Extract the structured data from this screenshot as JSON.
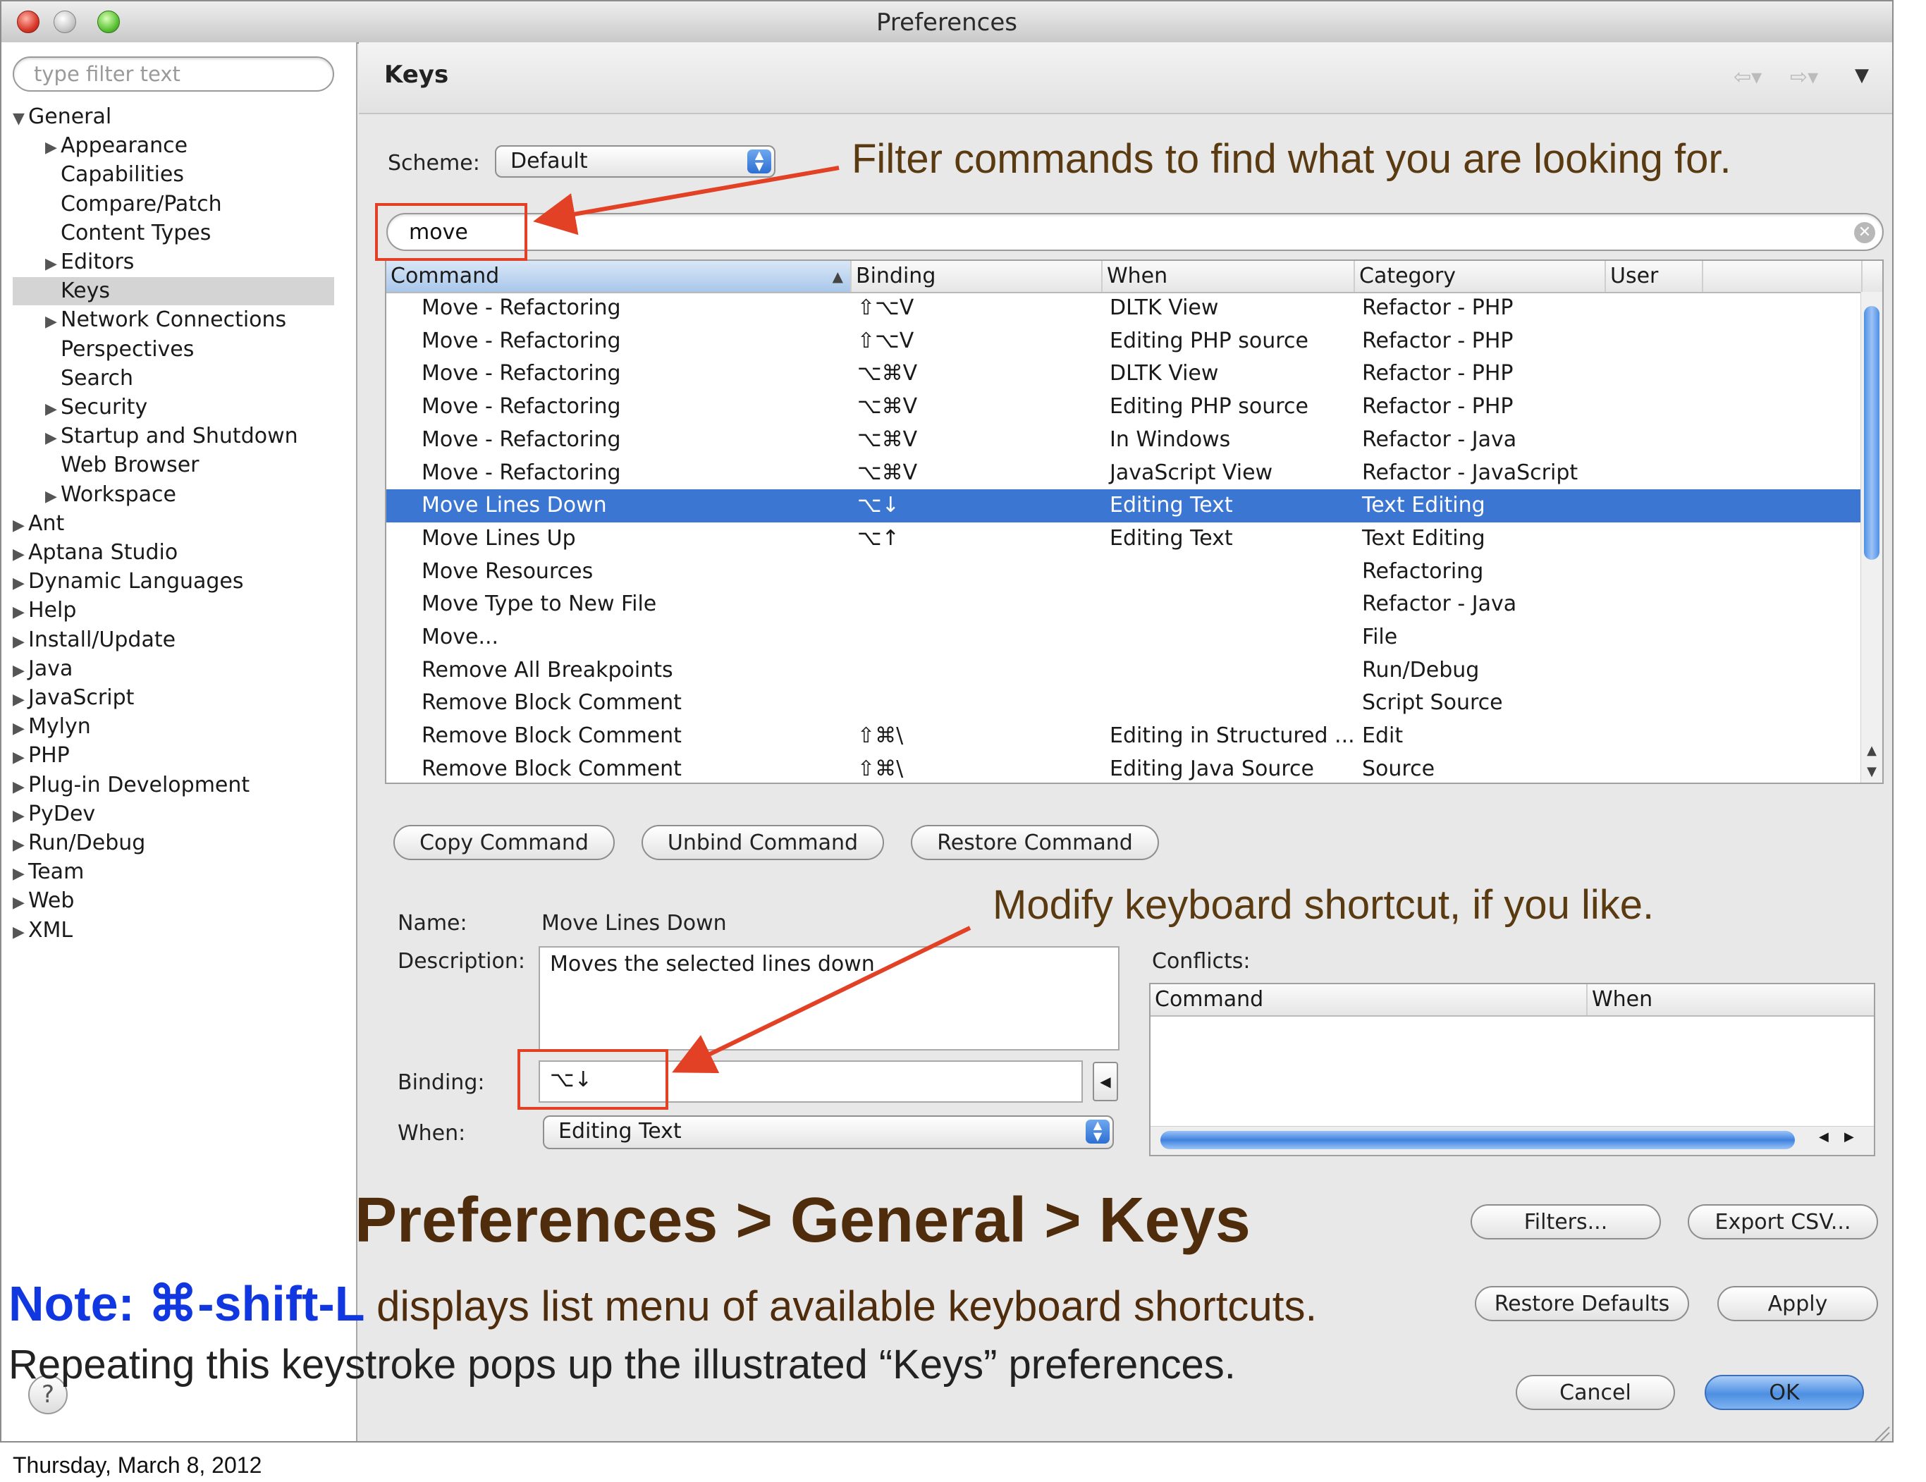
{
  "window": {
    "title": "Preferences"
  },
  "sidebar": {
    "filter_placeholder": "type filter text",
    "items": [
      {
        "label": "General",
        "expanded": true
      },
      {
        "label": "Appearance",
        "expandable": true
      },
      {
        "label": "Capabilities"
      },
      {
        "label": "Compare/Patch"
      },
      {
        "label": "Content Types"
      },
      {
        "label": "Editors",
        "expandable": true
      },
      {
        "label": "Keys",
        "selected": true
      },
      {
        "label": "Network Connections",
        "expandable": true
      },
      {
        "label": "Perspectives"
      },
      {
        "label": "Search"
      },
      {
        "label": "Security",
        "expandable": true
      },
      {
        "label": "Startup and Shutdown",
        "expandable": true
      },
      {
        "label": "Web Browser"
      },
      {
        "label": "Workspace",
        "expandable": true
      },
      {
        "label": "Ant",
        "expandable": true
      },
      {
        "label": "Aptana Studio",
        "expandable": true
      },
      {
        "label": "Dynamic Languages",
        "expandable": true
      },
      {
        "label": "Help",
        "expandable": true
      },
      {
        "label": "Install/Update",
        "expandable": true
      },
      {
        "label": "Java",
        "expandable": true
      },
      {
        "label": "JavaScript",
        "expandable": true
      },
      {
        "label": "Mylyn",
        "expandable": true
      },
      {
        "label": "PHP",
        "expandable": true
      },
      {
        "label": "Plug-in Development",
        "expandable": true
      },
      {
        "label": "PyDev",
        "expandable": true
      },
      {
        "label": "Run/Debug",
        "expandable": true
      },
      {
        "label": "Team",
        "expandable": true
      },
      {
        "label": "Web",
        "expandable": true
      },
      {
        "label": "XML",
        "expandable": true
      }
    ]
  },
  "keys": {
    "title": "Keys",
    "scheme_label": "Scheme:",
    "scheme_value": "Default",
    "search_value": "move",
    "columns": [
      "Command",
      "Binding",
      "When",
      "Category",
      "User"
    ],
    "rows": [
      {
        "command": "Move - Refactoring",
        "binding": "⇧⌥V",
        "when": "DLTK View",
        "category": "Refactor - PHP",
        "user": ""
      },
      {
        "command": "Move - Refactoring",
        "binding": "⇧⌥V",
        "when": "Editing PHP source",
        "category": "Refactor - PHP",
        "user": ""
      },
      {
        "command": "Move - Refactoring",
        "binding": "⌥⌘V",
        "when": "DLTK View",
        "category": "Refactor - PHP",
        "user": ""
      },
      {
        "command": "Move - Refactoring",
        "binding": "⌥⌘V",
        "when": "Editing PHP source",
        "category": "Refactor - PHP",
        "user": ""
      },
      {
        "command": "Move - Refactoring",
        "binding": "⌥⌘V",
        "when": "In Windows",
        "category": "Refactor - Java",
        "user": ""
      },
      {
        "command": "Move - Refactoring",
        "binding": "⌥⌘V",
        "when": "JavaScript View",
        "category": "Refactor - JavaScript",
        "user": ""
      },
      {
        "command": "Move Lines Down",
        "binding": "⌥↓",
        "when": "Editing Text",
        "category": "Text Editing",
        "user": "",
        "selected": true
      },
      {
        "command": "Move Lines Up",
        "binding": "⌥↑",
        "when": "Editing Text",
        "category": "Text Editing",
        "user": ""
      },
      {
        "command": "Move Resources",
        "binding": "",
        "when": "",
        "category": "Refactoring",
        "user": ""
      },
      {
        "command": "Move Type to New File",
        "binding": "",
        "when": "",
        "category": "Refactor - Java",
        "user": ""
      },
      {
        "command": "Move...",
        "binding": "",
        "when": "",
        "category": "File",
        "user": ""
      },
      {
        "command": "Remove All Breakpoints",
        "binding": "",
        "when": "",
        "category": "Run/Debug",
        "user": ""
      },
      {
        "command": "Remove Block Comment",
        "binding": "",
        "when": "",
        "category": "Script Source",
        "user": ""
      },
      {
        "command": "Remove Block Comment",
        "binding": "⇧⌘\\",
        "when": "Editing in Structured ...",
        "category": "Edit",
        "user": ""
      },
      {
        "command": "Remove Block Comment",
        "binding": "⇧⌘\\",
        "when": "Editing Java Source",
        "category": "Source",
        "user": ""
      }
    ],
    "buttons": {
      "copy": "Copy Command",
      "unbind": "Unbind Command",
      "restore": "Restore Command",
      "filters": "Filters...",
      "export": "Export CSV...",
      "restore_defaults": "Restore Defaults",
      "apply": "Apply",
      "cancel": "Cancel",
      "ok": "OK"
    },
    "details": {
      "name_label": "Name:",
      "name_value": "Move Lines Down",
      "description_label": "Description:",
      "description_value": "Moves the selected lines down",
      "binding_label": "Binding:",
      "binding_value": "⌥↓",
      "when_label": "When:",
      "when_value": "Editing Text",
      "conflicts_label": "Conflicts:",
      "conflicts_columns": [
        "Command",
        "When"
      ]
    }
  },
  "annotations": {
    "filter_callout": "Filter commands to find what you are looking for.",
    "modify_callout": "Modify keyboard shortcut, if you like.",
    "heading": "Preferences > General > Keys",
    "note_key": "Note: ⌘-shift-L",
    "note_rest": " displays list menu of available keyboard shortcuts.",
    "repeat": "Repeating this keystroke pops up the illustrated “Keys” preferences.",
    "date": "Thursday, March 8, 2012",
    "arrow_color": "#e24125"
  }
}
